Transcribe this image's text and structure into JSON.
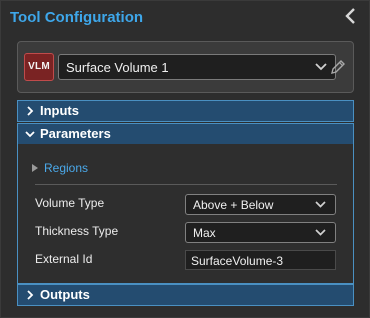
{
  "header": {
    "title": "Tool Configuration"
  },
  "tool": {
    "badge": "VLM",
    "selected": "Surface Volume 1"
  },
  "sections": {
    "inputs": {
      "label": "Inputs"
    },
    "parameters": {
      "label": "Parameters"
    },
    "outputs": {
      "label": "Outputs"
    }
  },
  "parameters": {
    "regions_label": "Regions",
    "volume_type": {
      "label": "Volume Type",
      "value": "Above + Below"
    },
    "thickness_type": {
      "label": "Thickness Type",
      "value": "Max"
    },
    "external_id": {
      "label": "External Id",
      "value": "SurfaceVolume-3"
    }
  },
  "colors": {
    "accent": "#3ea7ea",
    "section_header": "#244c70",
    "badge": "#7a2323"
  },
  "icons": [
    "chevron-left-icon",
    "chevron-down-icon",
    "pencil-icon",
    "chevron-right-icon",
    "triangle-right-icon"
  ]
}
